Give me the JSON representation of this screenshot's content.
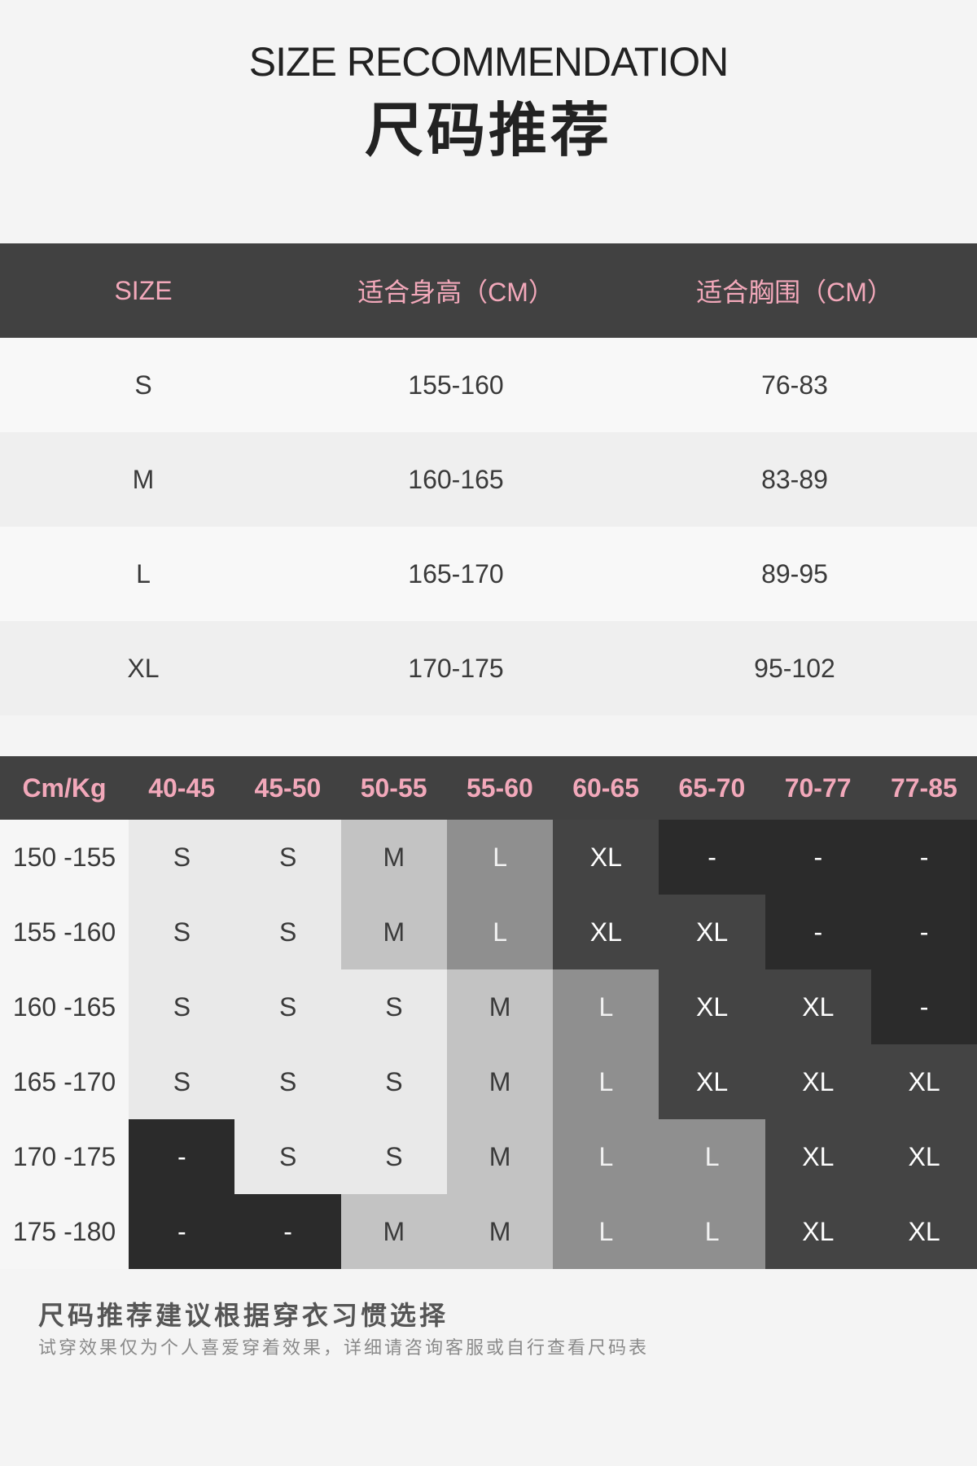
{
  "header": {
    "title_en": "SIZE RECOMMENDATION",
    "title_cn": "尺码推荐"
  },
  "size_table": {
    "headers": [
      "SIZE",
      "适合身高（CM）",
      "适合胸围（CM）"
    ],
    "rows": [
      [
        "S",
        "155-160",
        "76-83"
      ],
      [
        "M",
        "160-165",
        "83-89"
      ],
      [
        "L",
        "165-170",
        "89-95"
      ],
      [
        "XL",
        "170-175",
        "95-102"
      ]
    ]
  },
  "weight_table": {
    "corner": "Cm/Kg",
    "columns": [
      "40-45",
      "45-50",
      "50-55",
      "55-60",
      "60-65",
      "65-70",
      "70-77",
      "77-85"
    ],
    "rows": [
      {
        "label": "150 -155",
        "cells": [
          "S",
          "S",
          "M",
          "L",
          "XL",
          "-",
          "-",
          "-"
        ]
      },
      {
        "label": "155 -160",
        "cells": [
          "S",
          "S",
          "M",
          "L",
          "XL",
          "XL",
          "-",
          "-"
        ]
      },
      {
        "label": "160 -165",
        "cells": [
          "S",
          "S",
          "S",
          "M",
          "L",
          "XL",
          "XL",
          "-"
        ]
      },
      {
        "label": "165 -170",
        "cells": [
          "S",
          "S",
          "S",
          "M",
          "L",
          "XL",
          "XL",
          "XL"
        ]
      },
      {
        "label": "170 -175",
        "cells": [
          "-",
          "S",
          "S",
          "M",
          "L",
          "L",
          "XL",
          "XL"
        ]
      },
      {
        "label": "175 -180",
        "cells": [
          "-",
          "-",
          "M",
          "M",
          "L",
          "L",
          "XL",
          "XL"
        ]
      }
    ],
    "colors": {
      "S": "#e9e9e9",
      "M": "#c3c3c3",
      "L": "#8f8f8f",
      "XL": "#444444",
      "-": "#2b2b2b"
    },
    "text_colors": {
      "S": "#3a3a3a",
      "M": "#3a3a3a",
      "L": "#f2f2f2",
      "XL": "#ffffff",
      "-": "#ffffff"
    }
  },
  "notes": {
    "title": "尺码推荐建议根据穿衣习惯选择",
    "subtitle": "试穿效果仅为个人喜爱穿着效果，详细请咨询客服或自行查看尺码表"
  }
}
